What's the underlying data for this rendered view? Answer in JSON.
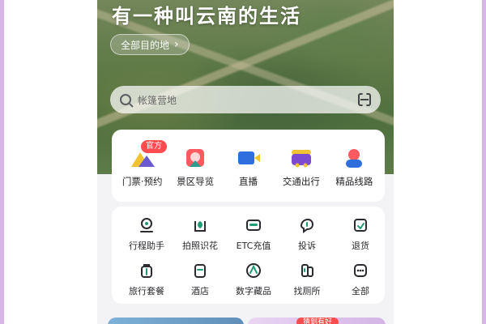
{
  "hero": {
    "title": "有一种叫云南的生活",
    "destinations_label": "全部目的地",
    "destinations_chevron": "›"
  },
  "search": {
    "placeholder": "帐篷营地",
    "icon": "search-icon",
    "scan_icon": "scan-icon"
  },
  "features": [
    {
      "label": "门票·预约",
      "icon": "ticket-icon"
    },
    {
      "label": "景区导览",
      "icon": "map-guide-icon"
    },
    {
      "label": "直播",
      "icon": "live-camera-icon"
    },
    {
      "label": "交通出行",
      "icon": "transport-icon"
    },
    {
      "label": "精品线路",
      "icon": "route-person-icon"
    }
  ],
  "feature_badge": "官方",
  "services": [
    {
      "label": "行程助手",
      "icon": "itinerary-icon"
    },
    {
      "label": "拍照识花",
      "icon": "flower-scan-icon"
    },
    {
      "label": "ETC充值",
      "icon": "etc-card-icon"
    },
    {
      "label": "投诉",
      "icon": "complaint-icon"
    },
    {
      "label": "退货",
      "icon": "return-icon"
    },
    {
      "label": "旅行套餐",
      "icon": "luggage-icon"
    },
    {
      "label": "酒店",
      "icon": "hotel-icon"
    },
    {
      "label": "数字藏品",
      "icon": "digital-collection-icon"
    },
    {
      "label": "找厕所",
      "icon": "restroom-icon"
    },
    {
      "label": "全部",
      "icon": "more-icon"
    }
  ],
  "promo_badge": "猜到有好",
  "colors": {
    "frame_border": "#d7b7e9",
    "badge_red": "#ff4d4f",
    "green_accent": "#1f9b75"
  }
}
